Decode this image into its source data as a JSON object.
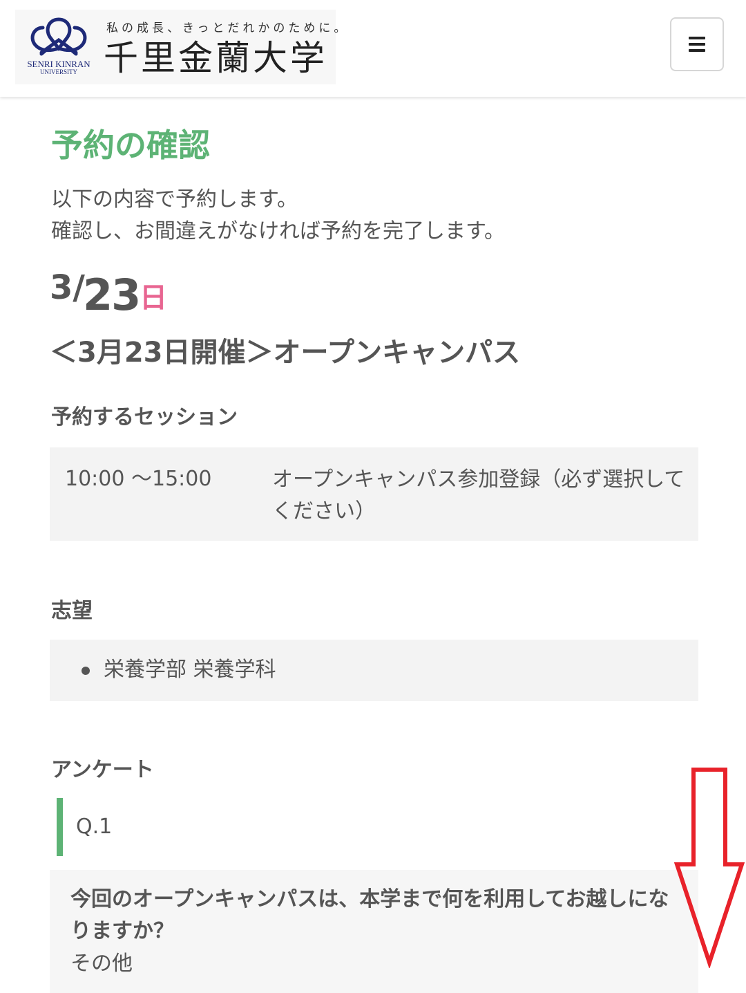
{
  "header": {
    "logo_en": "SENRI KINRAN",
    "logo_en_sub": "UNIVERSITY",
    "tagline": "私の成長、きっとだれかのために。",
    "university_name": "千里金蘭大学",
    "menu_icon": "hamburger-icon"
  },
  "page": {
    "title": "予約の確認",
    "intro_line1": "以下の内容で予約します。",
    "intro_line2": "確認し、お間違えがなければ予約を完了します。"
  },
  "event": {
    "date_month": "3/",
    "date_day": "23",
    "weekday": "日",
    "title": "＜3月23日開催＞オープンキャンパス"
  },
  "session": {
    "label": "予約するセッション",
    "time": "10:00 ～15:00",
    "name": "オープンキャンパス参加登録（必ず選択してください）"
  },
  "wish": {
    "label": "志望",
    "items": [
      "栄養学部 栄養学科"
    ]
  },
  "survey": {
    "label": "アンケート",
    "question_number": "Q.1",
    "question": "今回のオープンキャンパスは、本学まで何を利用してお越しになりますか？",
    "answer": "その他"
  },
  "overlay": {
    "arrow_icon": "down-arrow-icon",
    "arrow_color": "#e8222a"
  },
  "colors": {
    "accent_green": "#5db375",
    "weekday_pink": "#e86591",
    "logo_navy": "#1e2a78"
  }
}
